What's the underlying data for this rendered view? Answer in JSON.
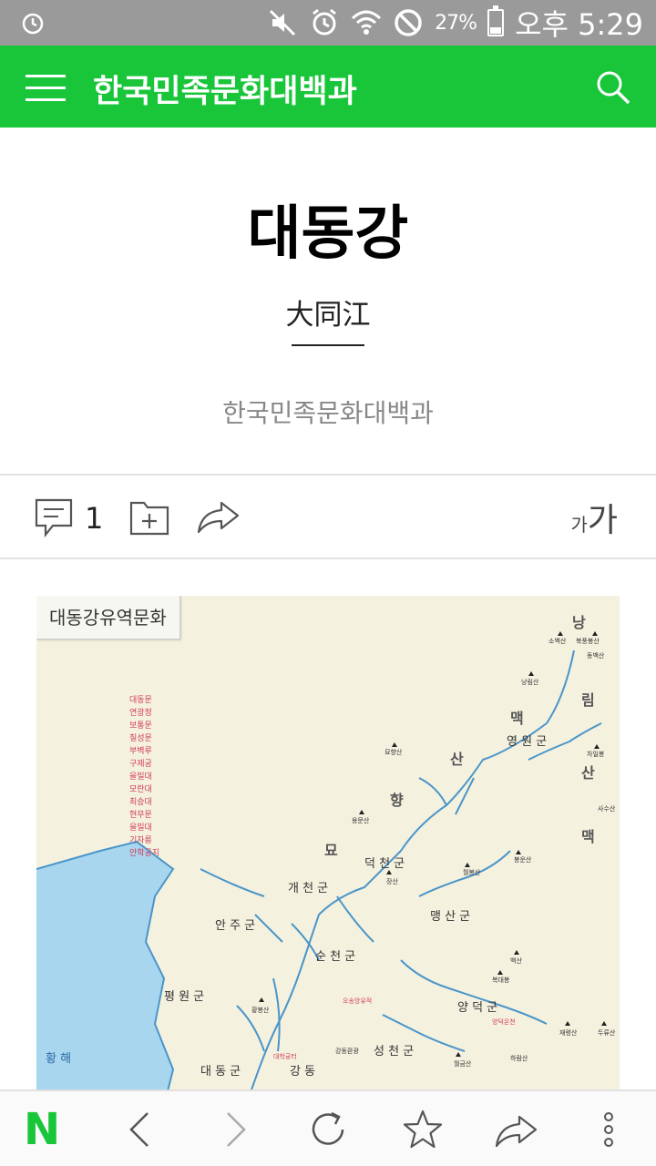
{
  "status_bar": {
    "battery": "27%",
    "time": "오후 5:29",
    "icons": [
      "alarm-icon",
      "mute-icon",
      "alarm-clock-icon",
      "wifi-icon",
      "no-disturb-icon",
      "battery-icon"
    ]
  },
  "app_bar": {
    "title": "한국민족문화대백과",
    "menu_icon": "menu-icon",
    "search_icon": "search-icon",
    "color": "#19c63a"
  },
  "article": {
    "title": "대동강",
    "hanja": "大同江",
    "source": "한국민족문화대백과"
  },
  "actions": {
    "comment_count": "1",
    "font_small": "가",
    "font_big": "가"
  },
  "map": {
    "caption": "대동강유역문화",
    "legend": [
      "대동문",
      "연광정",
      "보통문",
      "칠성문",
      "부벽루",
      "구제궁",
      "을밀대",
      "모란대",
      "최승대",
      "현무문",
      "을밀대",
      "기자릉",
      "안학궁지"
    ],
    "places": {
      "yeongwon": "영 원 군",
      "deokcheon": "덕 천 군",
      "gaecheon": "개 천 군",
      "anju": "안 주 군",
      "maengsan": "맹 산 군",
      "suncheon": "순 천 군",
      "pyeongwon": "평 원 군",
      "yangdeok": "양 덕 군",
      "seongcheon": "성 천 군",
      "daedong": "대 동 군",
      "gangdong": "강 동",
      "sea": "황   해"
    },
    "mountain_range": [
      "낭",
      "림",
      "산",
      "맥",
      "묘",
      "향",
      "산",
      "맥"
    ],
    "peaks": [
      "소백산",
      "북풍봉산",
      "동백산",
      "낭림산",
      "차일봉",
      "묘향산",
      "용문산",
      "장산",
      "사수산",
      "봉운산",
      "월봉산",
      "백산",
      "복대봉",
      "재령산",
      "두류산",
      "황봉산",
      "월금산",
      "하람산"
    ],
    "sites": [
      "오송앙유적",
      "대학궁터",
      "강동환광",
      "양덕온천"
    ]
  },
  "bottom_nav": {
    "logo": "N",
    "icons": [
      "back-icon",
      "forward-icon",
      "refresh-icon",
      "bookmark-icon",
      "share-icon",
      "more-icon"
    ]
  }
}
